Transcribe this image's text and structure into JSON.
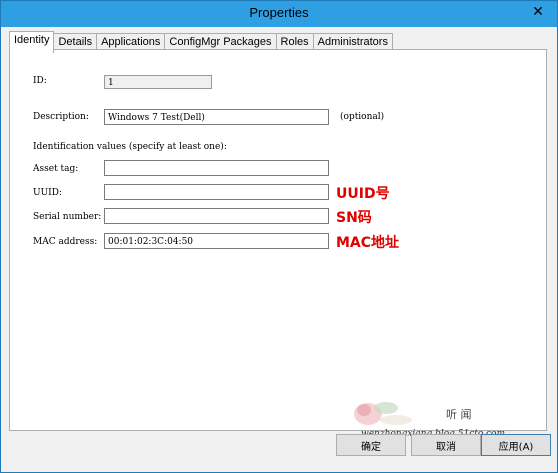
{
  "window": {
    "title": "Properties",
    "close_glyph": "✕"
  },
  "tabs": [
    {
      "label": "Identity"
    },
    {
      "label": "Details"
    },
    {
      "label": "Applications"
    },
    {
      "label": "ConfigMgr Packages"
    },
    {
      "label": "Roles"
    },
    {
      "label": "Administrators"
    }
  ],
  "form": {
    "id_label": "ID:",
    "id_value": "1",
    "description_label": "Description:",
    "description_value": "Windows 7 Test(Dell)",
    "optional_label": "(optional)",
    "identification_heading": "Identification values (specify at least one):",
    "asset_tag_label": "Asset tag:",
    "asset_tag_value": "",
    "uuid_label": "UUID:",
    "uuid_value": "",
    "serial_label": "Serial number:",
    "serial_value": "",
    "mac_label": "MAC address:",
    "mac_value": "00:01:02:3C:04:50"
  },
  "annotations": {
    "uuid": "UUID号",
    "serial": "SN码",
    "mac": "MAC地址"
  },
  "watermark": {
    "title": "听 闻",
    "site": "wenzhongxiang.blog.51cto.com"
  },
  "buttons": {
    "ok": "确定",
    "cancel": "取消",
    "apply": "应用(A)"
  }
}
